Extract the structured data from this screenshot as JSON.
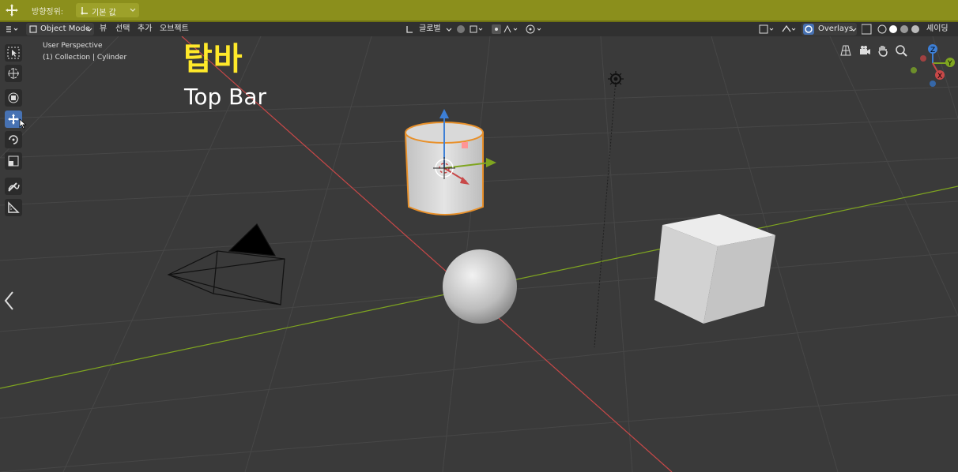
{
  "topbar": {
    "orientation_label": "방향정위:",
    "orientation_value": "기본 값"
  },
  "header": {
    "mode": "Object Mode",
    "menus": [
      "뷰",
      "선택",
      "추가",
      "오브젝트"
    ],
    "transform_orientation": "글로벌",
    "overlays": "Overlays",
    "shading": "셰이딩"
  },
  "viewport": {
    "perspective": "User Perspective",
    "collection_info": "(1) Collection | Cylinder",
    "overlay_title_ko": "탑바",
    "overlay_title_en": "Top Bar"
  },
  "colors": {
    "topbar_bg": "#8b8f1c",
    "viewport_bg": "#3a3a3a",
    "active_tool": "#4772b3",
    "title_ko": "#ffe92a",
    "axis_x": "#c84848",
    "axis_y": "#7fa520",
    "axis_z": "#3d7fd6",
    "selection_outline": "#e8902a"
  },
  "icons": [
    "move-icon",
    "select-box-icon",
    "cursor-icon",
    "transform-icon",
    "rotate-icon",
    "scale-icon",
    "annotate-icon",
    "measure-icon",
    "grid-view-icon",
    "camera-view-icon",
    "pan-hand-icon",
    "zoom-icon",
    "light-icon",
    "back-arrow-icon"
  ]
}
